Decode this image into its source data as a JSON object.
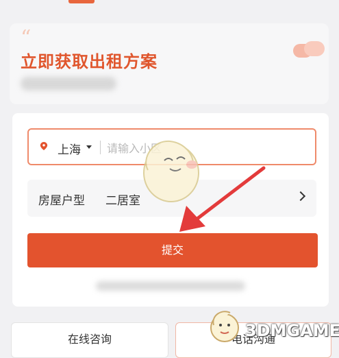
{
  "hero": {
    "title": "立即获取出租方案",
    "quote_mark": "“"
  },
  "form": {
    "city": "上海",
    "community_placeholder": "请输入小区",
    "house_type_label": "房屋户型",
    "house_type_value": "二居室",
    "submit_label": "提交"
  },
  "footer": {
    "consult_label": "在线咨询",
    "call_label": "电话沟通"
  },
  "watermark": {
    "text": "3DMGAME"
  },
  "colors": {
    "accent": "#e3532e",
    "title": "#e0562d",
    "input_border": "#ef8a6a"
  },
  "icons": [
    "location-pin-icon",
    "caret-down-icon",
    "chevron-right-icon"
  ]
}
